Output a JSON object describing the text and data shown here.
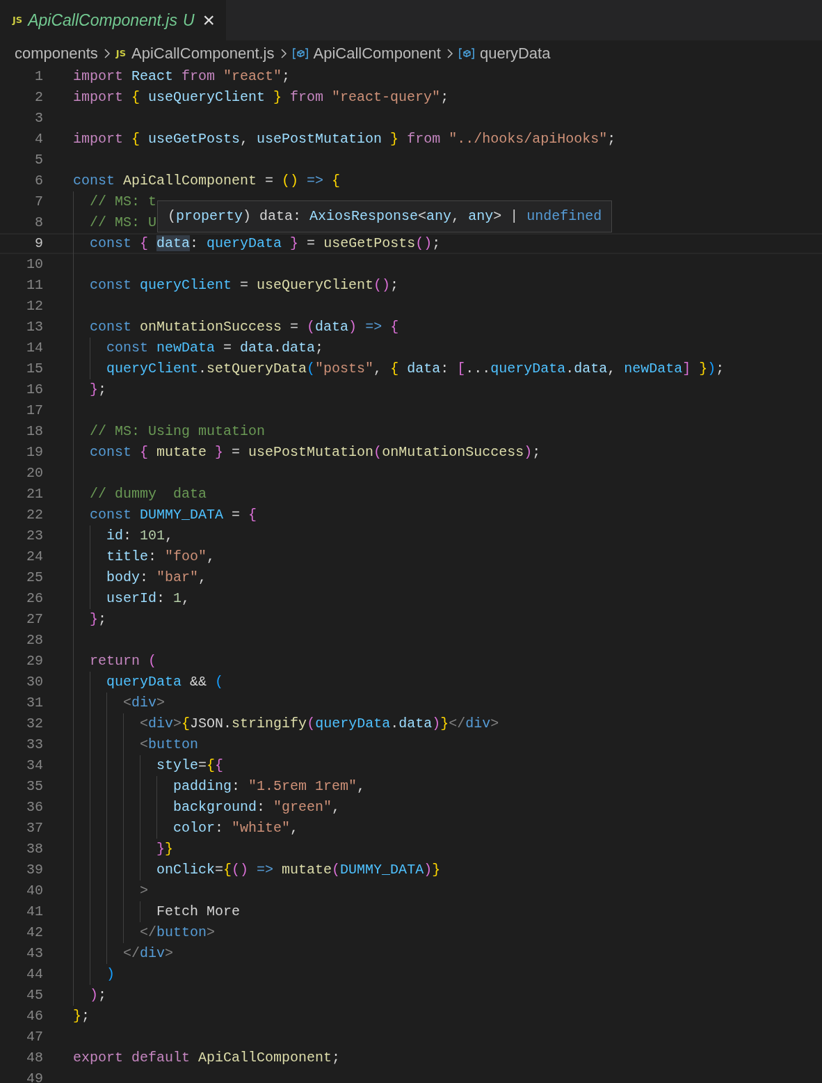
{
  "tabs": [
    {
      "icon": "JS",
      "title": "ApiCallComponent.js",
      "status": "U",
      "close": "×",
      "selected": true
    }
  ],
  "breadcrumbs": [
    {
      "kind": "folder",
      "label": "components"
    },
    {
      "kind": "file",
      "icon": "JS",
      "label": "ApiCallComponent.js"
    },
    {
      "kind": "symbol",
      "label": "ApiCallComponent"
    },
    {
      "kind": "symbol",
      "label": "queryData"
    }
  ],
  "lines": [
    {
      "number": "1",
      "current": false,
      "tokens": [
        {
          "kind": "control",
          "text": "import "
        },
        {
          "kind": "variable",
          "text": "React"
        },
        {
          "kind": "control",
          "text": " from "
        },
        {
          "kind": "string",
          "text": "\"react\""
        },
        {
          "kind": "plain",
          "text": ";"
        }
      ]
    },
    {
      "number": "2",
      "current": false,
      "tokens": [
        {
          "kind": "control",
          "text": "import "
        },
        {
          "kind": "bracket1",
          "text": "{ "
        },
        {
          "kind": "variable",
          "text": "useQueryClient"
        },
        {
          "kind": "bracket1",
          "text": " }"
        },
        {
          "kind": "control",
          "text": " from "
        },
        {
          "kind": "string",
          "text": "\"react-query\""
        },
        {
          "kind": "plain",
          "text": ";"
        }
      ]
    },
    {
      "number": "3",
      "current": false
    },
    {
      "number": "4",
      "current": false,
      "tokens": [
        {
          "kind": "control",
          "text": "import "
        },
        {
          "kind": "bracket1",
          "text": "{ "
        },
        {
          "kind": "variable",
          "text": "useGetPosts"
        },
        {
          "kind": "plain",
          "text": ", "
        },
        {
          "kind": "variable",
          "text": "usePostMutation"
        },
        {
          "kind": "bracket1",
          "text": " }"
        },
        {
          "kind": "control",
          "text": " from "
        },
        {
          "kind": "string",
          "text": "\"../hooks/apiHooks\""
        },
        {
          "kind": "plain",
          "text": ";"
        }
      ]
    },
    {
      "number": "5",
      "current": false
    },
    {
      "number": "6",
      "current": false,
      "tokens": [
        {
          "kind": "keyword",
          "text": "const "
        },
        {
          "kind": "function",
          "text": "ApiCallComponent"
        },
        {
          "kind": "plain",
          "text": " = "
        },
        {
          "kind": "bracket1",
          "text": "()"
        },
        {
          "kind": "keyword",
          "text": " => "
        },
        {
          "kind": "bracket1",
          "text": "{"
        }
      ]
    },
    {
      "number": "7",
      "current": false,
      "tokens": [
        {
          "kind": "comment",
          "text": "  // MS: t"
        }
      ]
    },
    {
      "number": "8",
      "current": false,
      "tokens": [
        {
          "kind": "comment",
          "text": "  // MS: U"
        }
      ]
    },
    {
      "number": "9",
      "current": true,
      "tokens": [
        {
          "kind": "keyword",
          "text": "  const "
        },
        {
          "kind": "bracket2",
          "text": "{ "
        },
        {
          "kind": "highlight",
          "text": "data"
        },
        {
          "kind": "plain",
          "text": ": "
        },
        {
          "kind": "constant",
          "text": "queryData"
        },
        {
          "kind": "bracket2",
          "text": " }"
        },
        {
          "kind": "plain",
          "text": " = "
        },
        {
          "kind": "function",
          "text": "useGetPosts"
        },
        {
          "kind": "bracket2",
          "text": "()"
        },
        {
          "kind": "plain",
          "text": ";"
        }
      ]
    },
    {
      "number": "10",
      "current": false
    },
    {
      "number": "11",
      "current": false,
      "tokens": [
        {
          "kind": "keyword",
          "text": "  const "
        },
        {
          "kind": "constant",
          "text": "queryClient"
        },
        {
          "kind": "plain",
          "text": " = "
        },
        {
          "kind": "function",
          "text": "useQueryClient"
        },
        {
          "kind": "bracket2",
          "text": "()"
        },
        {
          "kind": "plain",
          "text": ";"
        }
      ]
    },
    {
      "number": "12",
      "current": false
    },
    {
      "number": "13",
      "current": false,
      "tokens": [
        {
          "kind": "keyword",
          "text": "  const "
        },
        {
          "kind": "function",
          "text": "onMutationSuccess"
        },
        {
          "kind": "plain",
          "text": " = "
        },
        {
          "kind": "bracket2",
          "text": "("
        },
        {
          "kind": "variable",
          "text": "data"
        },
        {
          "kind": "bracket2",
          "text": ")"
        },
        {
          "kind": "keyword",
          "text": " => "
        },
        {
          "kind": "bracket2",
          "text": "{"
        }
      ]
    },
    {
      "number": "14",
      "current": false,
      "tokens": [
        {
          "kind": "keyword",
          "text": "    const "
        },
        {
          "kind": "constant",
          "text": "newData"
        },
        {
          "kind": "plain",
          "text": " = "
        },
        {
          "kind": "variable",
          "text": "data"
        },
        {
          "kind": "plain",
          "text": "."
        },
        {
          "kind": "variable",
          "text": "data"
        },
        {
          "kind": "plain",
          "text": ";"
        }
      ]
    },
    {
      "number": "15",
      "current": false,
      "tokens": [
        {
          "kind": "constant",
          "text": "    queryClient"
        },
        {
          "kind": "plain",
          "text": "."
        },
        {
          "kind": "function",
          "text": "setQueryData"
        },
        {
          "kind": "bracket3",
          "text": "("
        },
        {
          "kind": "string",
          "text": "\"posts\""
        },
        {
          "kind": "plain",
          "text": ", "
        },
        {
          "kind": "bracket1",
          "text": "{ "
        },
        {
          "kind": "variable",
          "text": "data"
        },
        {
          "kind": "plain",
          "text": ": "
        },
        {
          "kind": "bracket2",
          "text": "["
        },
        {
          "kind": "plain",
          "text": "..."
        },
        {
          "kind": "constant",
          "text": "queryData"
        },
        {
          "kind": "plain",
          "text": "."
        },
        {
          "kind": "variable",
          "text": "data"
        },
        {
          "kind": "plain",
          "text": ", "
        },
        {
          "kind": "constant",
          "text": "newData"
        },
        {
          "kind": "bracket2",
          "text": "]"
        },
        {
          "kind": "bracket1",
          "text": " }"
        },
        {
          "kind": "bracket3",
          "text": ")"
        },
        {
          "kind": "plain",
          "text": ";"
        }
      ]
    },
    {
      "number": "16",
      "current": false,
      "tokens": [
        {
          "kind": "bracket2",
          "text": "  }"
        },
        {
          "kind": "plain",
          "text": ";"
        }
      ]
    },
    {
      "number": "17",
      "current": false
    },
    {
      "number": "18",
      "current": false,
      "tokens": [
        {
          "kind": "comment",
          "text": "  // MS: Using mutation"
        }
      ]
    },
    {
      "number": "19",
      "current": false,
      "tokens": [
        {
          "kind": "keyword",
          "text": "  const "
        },
        {
          "kind": "bracket2",
          "text": "{ "
        },
        {
          "kind": "function",
          "text": "mutate"
        },
        {
          "kind": "bracket2",
          "text": " }"
        },
        {
          "kind": "plain",
          "text": " = "
        },
        {
          "kind": "function",
          "text": "usePostMutation"
        },
        {
          "kind": "bracket2",
          "text": "("
        },
        {
          "kind": "function",
          "text": "onMutationSuccess"
        },
        {
          "kind": "bracket2",
          "text": ")"
        },
        {
          "kind": "plain",
          "text": ";"
        }
      ]
    },
    {
      "number": "20",
      "current": false
    },
    {
      "number": "21",
      "current": false,
      "tokens": [
        {
          "kind": "comment",
          "text": "  // dummy  data"
        }
      ]
    },
    {
      "number": "22",
      "current": false,
      "tokens": [
        {
          "kind": "keyword",
          "text": "  const "
        },
        {
          "kind": "constant",
          "text": "DUMMY_DATA"
        },
        {
          "kind": "plain",
          "text": " = "
        },
        {
          "kind": "bracket2",
          "text": "{"
        }
      ]
    },
    {
      "number": "23",
      "current": false,
      "tokens": [
        {
          "kind": "variable",
          "text": "    id"
        },
        {
          "kind": "plain",
          "text": ": "
        },
        {
          "kind": "number",
          "text": "101"
        },
        {
          "kind": "plain",
          "text": ","
        }
      ]
    },
    {
      "number": "24",
      "current": false,
      "tokens": [
        {
          "kind": "variable",
          "text": "    title"
        },
        {
          "kind": "plain",
          "text": ": "
        },
        {
          "kind": "string",
          "text": "\"foo\""
        },
        {
          "kind": "plain",
          "text": ","
        }
      ]
    },
    {
      "number": "25",
      "current": false,
      "tokens": [
        {
          "kind": "variable",
          "text": "    body"
        },
        {
          "kind": "plain",
          "text": ": "
        },
        {
          "kind": "string",
          "text": "\"bar\""
        },
        {
          "kind": "plain",
          "text": ","
        }
      ]
    },
    {
      "number": "26",
      "current": false,
      "tokens": [
        {
          "kind": "variable",
          "text": "    userId"
        },
        {
          "kind": "plain",
          "text": ": "
        },
        {
          "kind": "number",
          "text": "1"
        },
        {
          "kind": "plain",
          "text": ","
        }
      ]
    },
    {
      "number": "27",
      "current": false,
      "tokens": [
        {
          "kind": "bracket2",
          "text": "  }"
        },
        {
          "kind": "plain",
          "text": ";"
        }
      ]
    },
    {
      "number": "28",
      "current": false
    },
    {
      "number": "29",
      "current": false,
      "tokens": [
        {
          "kind": "control",
          "text": "  return "
        },
        {
          "kind": "bracket2",
          "text": "("
        }
      ]
    },
    {
      "number": "30",
      "current": false,
      "tokens": [
        {
          "kind": "constant",
          "text": "    queryData"
        },
        {
          "kind": "plain",
          "text": " && "
        },
        {
          "kind": "bracket3",
          "text": "("
        }
      ]
    },
    {
      "number": "31",
      "current": false,
      "tokens": [
        {
          "kind": "angle",
          "text": "      <"
        },
        {
          "kind": "tag",
          "text": "div"
        },
        {
          "kind": "angle",
          "text": ">"
        }
      ]
    },
    {
      "number": "32",
      "current": false,
      "tokens": [
        {
          "kind": "angle",
          "text": "        <"
        },
        {
          "kind": "tag",
          "text": "div"
        },
        {
          "kind": "angle",
          "text": ">"
        },
        {
          "kind": "bracket1",
          "text": "{"
        },
        {
          "kind": "plain",
          "text": "JSON"
        },
        {
          "kind": "plain",
          "text": "."
        },
        {
          "kind": "function",
          "text": "stringify"
        },
        {
          "kind": "bracket2",
          "text": "("
        },
        {
          "kind": "constant",
          "text": "queryData"
        },
        {
          "kind": "plain",
          "text": "."
        },
        {
          "kind": "variable",
          "text": "data"
        },
        {
          "kind": "bracket2",
          "text": ")"
        },
        {
          "kind": "bracket1",
          "text": "}"
        },
        {
          "kind": "angle",
          "text": "</"
        },
        {
          "kind": "tag",
          "text": "div"
        },
        {
          "kind": "angle",
          "text": ">"
        }
      ]
    },
    {
      "number": "33",
      "current": false,
      "tokens": [
        {
          "kind": "angle",
          "text": "        <"
        },
        {
          "kind": "tag",
          "text": "button"
        }
      ]
    },
    {
      "number": "34",
      "current": false,
      "tokens": [
        {
          "kind": "variable",
          "text": "          style"
        },
        {
          "kind": "plain",
          "text": "="
        },
        {
          "kind": "bracket1",
          "text": "{"
        },
        {
          "kind": "bracket2",
          "text": "{"
        }
      ]
    },
    {
      "number": "35",
      "current": false,
      "tokens": [
        {
          "kind": "variable",
          "text": "            padding"
        },
        {
          "kind": "plain",
          "text": ": "
        },
        {
          "kind": "string",
          "text": "\"1.5rem 1rem\""
        },
        {
          "kind": "plain",
          "text": ","
        }
      ]
    },
    {
      "number": "36",
      "current": false,
      "tokens": [
        {
          "kind": "variable",
          "text": "            background"
        },
        {
          "kind": "plain",
          "text": ": "
        },
        {
          "kind": "string",
          "text": "\"green\""
        },
        {
          "kind": "plain",
          "text": ","
        }
      ]
    },
    {
      "number": "37",
      "current": false,
      "tokens": [
        {
          "kind": "variable",
          "text": "            color"
        },
        {
          "kind": "plain",
          "text": ": "
        },
        {
          "kind": "string",
          "text": "\"white\""
        },
        {
          "kind": "plain",
          "text": ","
        }
      ]
    },
    {
      "number": "38",
      "current": false,
      "tokens": [
        {
          "kind": "bracket2",
          "text": "          }"
        },
        {
          "kind": "bracket1",
          "text": "}"
        }
      ]
    },
    {
      "number": "39",
      "current": false,
      "tokens": [
        {
          "kind": "variable",
          "text": "          onClick"
        },
        {
          "kind": "plain",
          "text": "="
        },
        {
          "kind": "bracket1",
          "text": "{"
        },
        {
          "kind": "bracket2",
          "text": "()"
        },
        {
          "kind": "keyword",
          "text": " => "
        },
        {
          "kind": "function",
          "text": "mutate"
        },
        {
          "kind": "bracket2",
          "text": "("
        },
        {
          "kind": "constant",
          "text": "DUMMY_DATA"
        },
        {
          "kind": "bracket2",
          "text": ")"
        },
        {
          "kind": "bracket1",
          "text": "}"
        }
      ]
    },
    {
      "number": "40",
      "current": false,
      "tokens": [
        {
          "kind": "angle",
          "text": "        >"
        }
      ]
    },
    {
      "number": "41",
      "current": false,
      "tokens": [
        {
          "kind": "plain",
          "text": "          Fetch More"
        }
      ]
    },
    {
      "number": "42",
      "current": false,
      "tokens": [
        {
          "kind": "angle",
          "text": "        </"
        },
        {
          "kind": "tag",
          "text": "button"
        },
        {
          "kind": "angle",
          "text": ">"
        }
      ]
    },
    {
      "number": "43",
      "current": false,
      "tokens": [
        {
          "kind": "angle",
          "text": "      </"
        },
        {
          "kind": "tag",
          "text": "div"
        },
        {
          "kind": "angle",
          "text": ">"
        }
      ]
    },
    {
      "number": "44",
      "current": false,
      "tokens": [
        {
          "kind": "bracket3",
          "text": "    )"
        }
      ]
    },
    {
      "number": "45",
      "current": false,
      "tokens": [
        {
          "kind": "bracket2",
          "text": "  )"
        },
        {
          "kind": "plain",
          "text": ";"
        }
      ]
    },
    {
      "number": "46",
      "current": false,
      "tokens": [
        {
          "kind": "bracket1",
          "text": "}"
        },
        {
          "kind": "plain",
          "text": ";"
        }
      ]
    },
    {
      "number": "47",
      "current": false
    },
    {
      "number": "48",
      "current": false,
      "tokens": [
        {
          "kind": "control",
          "text": "export default "
        },
        {
          "kind": "function",
          "text": "ApiCallComponent"
        },
        {
          "kind": "plain",
          "text": ";"
        }
      ]
    },
    {
      "number": "49",
      "current": false
    }
  ],
  "tooltip": {
    "tokens": [
      {
        "kind": "plain",
        "text": "("
      },
      {
        "kind": "variable",
        "text": "property"
      },
      {
        "kind": "plain",
        "text": ") data: "
      },
      {
        "kind": "variable",
        "text": "AxiosResponse"
      },
      {
        "kind": "plain",
        "text": "<"
      },
      {
        "kind": "variable",
        "text": "any"
      },
      {
        "kind": "plain",
        "text": ", "
      },
      {
        "kind": "variable",
        "text": "any"
      },
      {
        "kind": "plain",
        "text": ">"
      },
      {
        "kind": "plain",
        "text": " | "
      },
      {
        "kind": "keyword",
        "text": "undefined"
      }
    ]
  }
}
